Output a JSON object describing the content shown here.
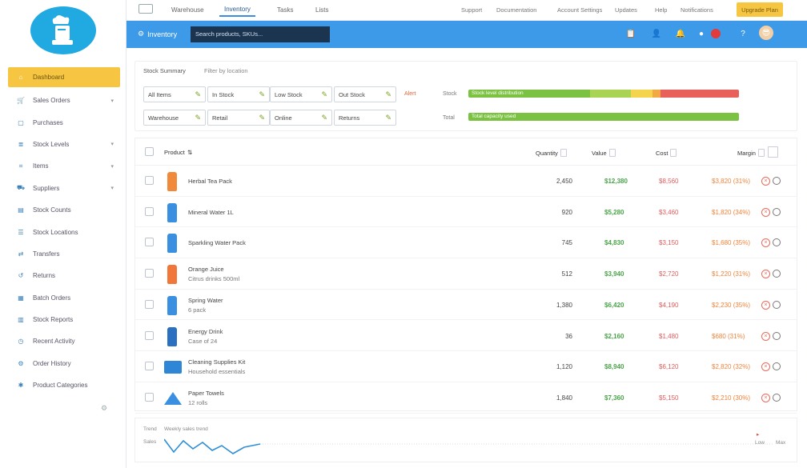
{
  "sidebar": {
    "items": [
      {
        "label": "Dashboard",
        "icon": "home-icon",
        "active": true,
        "chevron": false
      },
      {
        "label": "Sales Orders",
        "icon": "cart-icon",
        "active": false,
        "chevron": true
      },
      {
        "label": "Purchases",
        "icon": "box-icon",
        "active": false,
        "chevron": false
      },
      {
        "label": "Stock Levels",
        "icon": "layers-icon",
        "active": false,
        "chevron": true
      },
      {
        "label": "Items",
        "icon": "tag-icon",
        "active": false,
        "chevron": true
      },
      {
        "label": "Suppliers",
        "icon": "truck-icon",
        "active": false,
        "chevron": true
      },
      {
        "label": "Stock Counts",
        "icon": "clipboard-icon",
        "active": false,
        "chevron": false
      },
      {
        "label": "Stock Locations",
        "icon": "list-icon",
        "active": false,
        "chevron": false
      },
      {
        "label": "Transfers",
        "icon": "transfer-icon",
        "active": false,
        "chevron": false
      },
      {
        "label": "Returns",
        "icon": "return-icon",
        "active": false,
        "chevron": false
      },
      {
        "label": "Batch Orders",
        "icon": "grid-icon",
        "active": false,
        "chevron": false
      },
      {
        "label": "Stock Reports",
        "icon": "chart-icon",
        "active": false,
        "chevron": false
      },
      {
        "label": "Recent Activity",
        "icon": "clock-icon",
        "active": false,
        "chevron": false
      },
      {
        "label": "Order History",
        "icon": "gear-icon",
        "active": false,
        "chevron": false
      },
      {
        "label": "Product Categories",
        "icon": "settings-icon",
        "active": false,
        "chevron": false
      }
    ]
  },
  "topbar": {
    "tabs": [
      "Warehouse",
      "Inventory",
      "Tasks",
      "Lists"
    ],
    "links": [
      "Support",
      "Documentation",
      "Account Settings",
      "Updates",
      "Help",
      "Notifications"
    ],
    "cta": "Upgrade Plan"
  },
  "header": {
    "title": "Inventory",
    "search_value": "Search products, SKUs...",
    "colors": {
      "blue": "#3d9ae8",
      "accent": "#f6c642"
    }
  },
  "summary": {
    "label": "Stock Summary",
    "sublabel": "Filter by location",
    "chips_row1": [
      "All Items",
      "In Stock",
      "Low Stock",
      "Out Stock"
    ],
    "chips_row2": [
      "Warehouse",
      "Retail",
      "Online",
      "Returns"
    ],
    "badge": "Alert",
    "bar1_label": "Stock",
    "bar1_text": "Stock level distribution",
    "bar2_label": "Total",
    "bar2_text": "Total capacity used"
  },
  "table": {
    "headers": [
      "Product",
      "Quantity",
      "Value",
      "Cost",
      "Margin"
    ],
    "rows": [
      {
        "name": "Herbal Tea Pack",
        "name2": "",
        "qty": "2,450",
        "value": "$12,380",
        "cost": "$8,560",
        "margin": "$3,820 (31%)",
        "img": "orange-bottle"
      },
      {
        "name": "Mineral Water 1L",
        "name2": "",
        "qty": "920",
        "value": "$5,280",
        "cost": "$3,460",
        "margin": "$1,820 (34%)",
        "img": "blue-bottle"
      },
      {
        "name": "Sparkling Water Pack",
        "name2": "",
        "qty": "745",
        "value": "$4,830",
        "cost": "$3,150",
        "margin": "$1,680 (35%)",
        "img": "blue-small-bottle"
      },
      {
        "name": "Orange Juice",
        "name2": "Citrus drinks 500ml",
        "qty": "512",
        "value": "$3,940",
        "cost": "$2,720",
        "margin": "$1,220 (31%)",
        "img": "orange-juice"
      },
      {
        "name": "Spring Water",
        "name2": "6 pack",
        "qty": "1,380",
        "value": "$6,420",
        "cost": "$4,190",
        "margin": "$2,230 (35%)",
        "img": "water-bottle"
      },
      {
        "name": "Energy Drink",
        "name2": "Case of 24",
        "qty": "36",
        "value": "$2,160",
        "cost": "$1,480",
        "margin": "$680 (31%)",
        "img": "dark-blue-can"
      },
      {
        "name": "Cleaning Supplies Kit",
        "name2": "Household essentials",
        "qty": "1,120",
        "value": "$8,940",
        "cost": "$6,120",
        "margin": "$2,820 (32%)",
        "img": "blue-box"
      },
      {
        "name": "Paper Towels",
        "name2": "12 rolls",
        "qty": "1,840",
        "value": "$7,360",
        "cost": "$5,150",
        "margin": "$2,210 (30%)",
        "img": "blue-triangle"
      }
    ]
  },
  "bottom": {
    "label_top": "Trend",
    "label_left": "Sales",
    "sparkline": "Weekly sales trend",
    "right_label1": "Low",
    "right_label2": "Max"
  }
}
